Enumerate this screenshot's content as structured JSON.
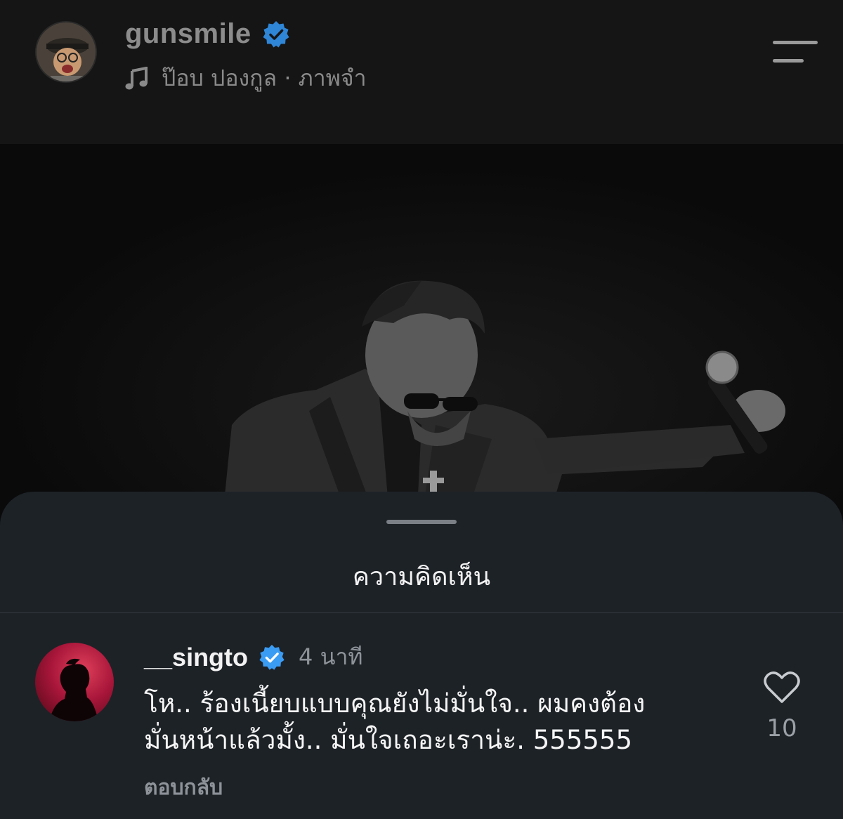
{
  "header": {
    "username": "gunsmile",
    "music_label": "ป๊อบ ปองกูล · ภาพจำ",
    "icons": {
      "verified": "verified-badge-icon",
      "music": "music-note-icon",
      "menu": "hamburger-menu-icon"
    }
  },
  "sheet": {
    "title": "ความคิดเห็น"
  },
  "comment": {
    "username": "__singto",
    "time": "4 นาที",
    "text_line1": "โห.. ร้องเนี้ยบแบบคุณยังไม่มั่นใจ.. ผมคงต้อง",
    "text_line2": "มั่นหน้าแล้วมั้ง.. มั่นใจเถอะเราน่ะ. 555555",
    "reply_label": "ตอบกลับ",
    "like_count": "10"
  },
  "colors": {
    "background": "#151515",
    "sheet": "#1d2227",
    "verified_blue": "#3b9cf4",
    "muted_text": "#8d9399"
  }
}
